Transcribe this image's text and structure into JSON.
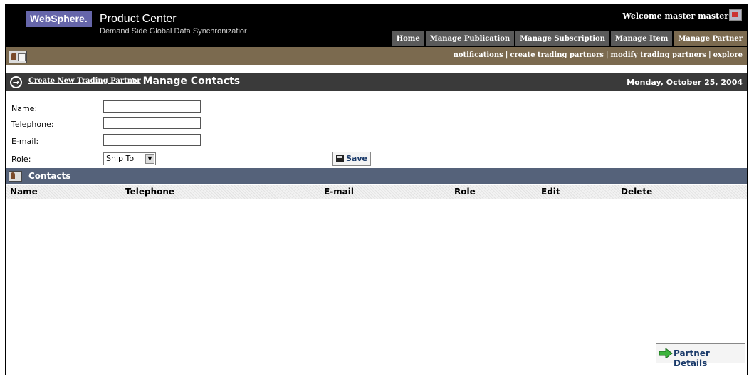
{
  "header": {
    "logo": "WebSphere.",
    "product": "Product Center",
    "subtitle": "Demand Side Global Data Synchronizatior",
    "welcome": "Welcome master master",
    "tabs": [
      {
        "label": "Home",
        "active": false
      },
      {
        "label": "Manage Publication",
        "active": false
      },
      {
        "label": "Manage Subscription",
        "active": false
      },
      {
        "label": "Manage Item",
        "active": false
      },
      {
        "label": "Manage Partner",
        "active": true
      }
    ]
  },
  "subnav": {
    "links": [
      "notifications",
      "create trading partners",
      "modify trading partners",
      "explore"
    ]
  },
  "breadcrumb": {
    "link": "Create New Trading Partner",
    "title": "> Manage Contacts",
    "date": "Monday, October 25, 2004"
  },
  "form": {
    "name_label": "Name:",
    "name_value": "",
    "telephone_label": "Telephone:",
    "telephone_value": "",
    "email_label": "E-mail:",
    "email_value": "",
    "role_label": "Role:",
    "role_value": "Ship To",
    "save_label": "Save"
  },
  "contacts": {
    "title": "Contacts",
    "columns": [
      "Name",
      "Telephone",
      "E-mail",
      "Role",
      "Edit",
      "Delete"
    ]
  },
  "footer": {
    "partner_details_label": "Partner Details"
  },
  "colors": {
    "header_bg": "#000000",
    "subnav_bg": "#7b6a4f",
    "breadcrumb_bg": "#3a3a3a",
    "contacts_bar_bg": "#55627a",
    "logo_bg": "#6666aa",
    "link_color": "#1a3a6a"
  }
}
